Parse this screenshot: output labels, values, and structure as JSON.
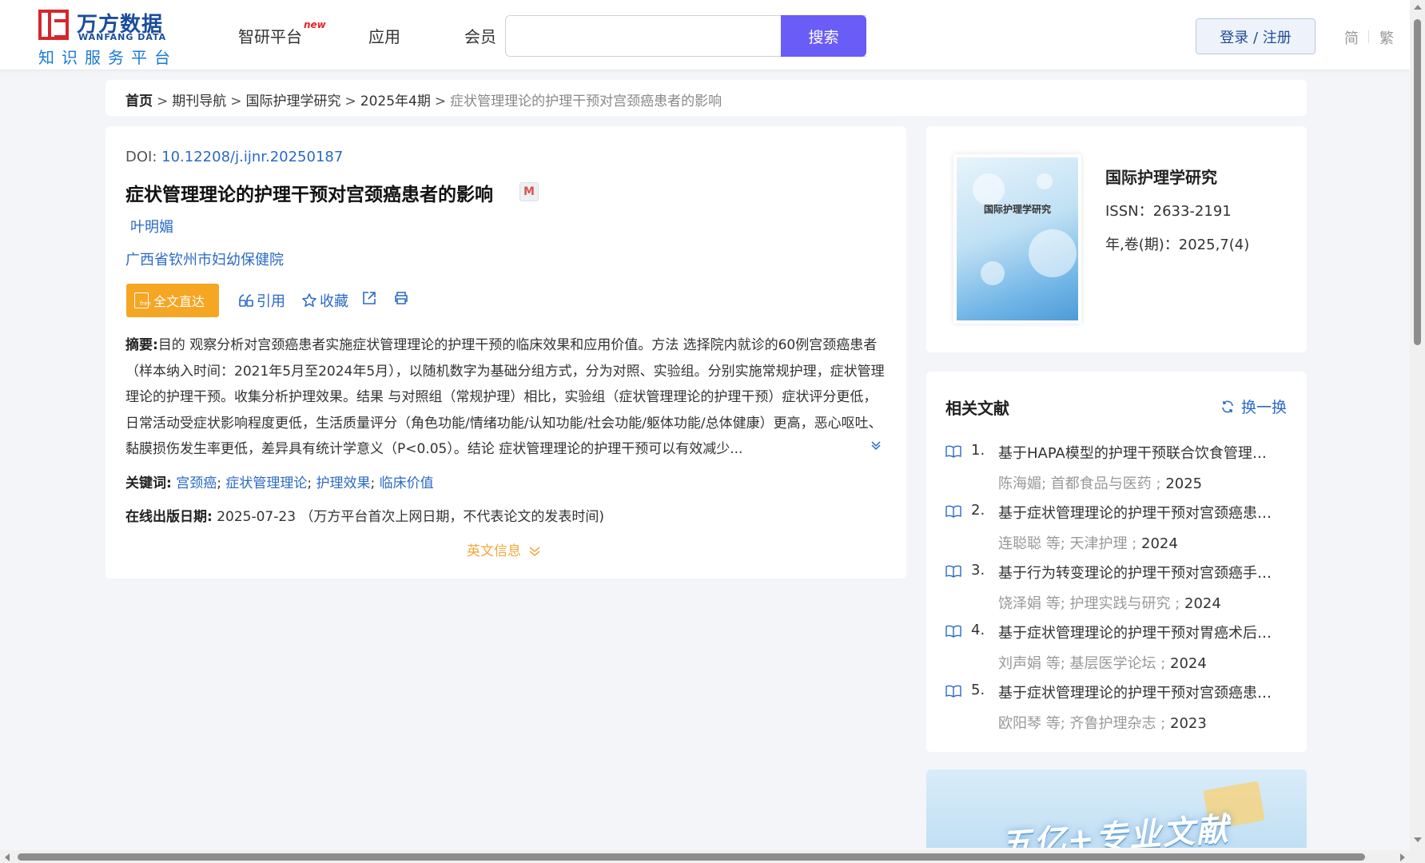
{
  "header": {
    "logo_cn": "万方数据",
    "logo_en": "WANFANG DATA",
    "logo_sub": "知识服务平台",
    "nav": [
      {
        "label": "智研平台",
        "badge": "new"
      },
      {
        "label": "应用"
      },
      {
        "label": "会员"
      }
    ],
    "search_placeholder": "",
    "search_button": "搜索",
    "login_button": "登录 / 注册",
    "lang_simplified": "简",
    "lang_traditional": "繁"
  },
  "breadcrumb": {
    "home": "首页",
    "items": [
      "期刊导航",
      "国际护理学研究",
      "2025年4期"
    ],
    "current": "症状管理理论的护理干预对宫颈癌患者的影响",
    "separator": ">"
  },
  "article": {
    "doi_label": "DOI:",
    "doi_value": "10.12208/j.ijnr.20250187",
    "title": "症状管理理论的护理干预对宫颈癌患者的影响",
    "title_badge": "M",
    "author": "叶明媚",
    "organization": "广西省钦州市妇幼保健院",
    "fulltext_button": "全文直达",
    "actions": {
      "cite": "引用",
      "collect": "收藏"
    },
    "abstract_label": "摘要:",
    "abstract_text": "目的 观察分析对宫颈癌患者实施症状管理理论的护理干预的临床效果和应用价值。方法 选择院内就诊的60例宫颈癌患者（样本纳入时间：2021年5月至2024年5月），以随机数字为基础分组方式，分为对照、实验组。分别实施常规护理，症状管理理论的护理干预。收集分析护理效果。结果 与对照组（常规护理）相比，实验组（症状管理理论的护理干预）症状评分更低，日常活动受症状影响程度更低，生活质量评分（角色功能/情绪功能/认知功能/社会功能/躯体功能/总体健康）更高，恶心呕吐、黏膜损伤发生率更低，差异具有统计学意义（P<0.05）。结论 症状管理理论的护理干预可以有效减少...",
    "keywords_label": "关键词:",
    "keywords": [
      "宫颈癌",
      "症状管理理论",
      "护理效果",
      "临床价值"
    ],
    "pubdate_label": "在线出版日期:",
    "pubdate_value": "2025-07-23 （万方平台首次上网日期，不代表论文的发表时间)",
    "english_info": "英文信息"
  },
  "journal": {
    "cover_title": "国际护理学研究",
    "name": "国际护理学研究",
    "issn": "ISSN：2633-2191",
    "volume": "年,卷(期)：2025,7(4)"
  },
  "related": {
    "title": "相关文献",
    "refresh": "换一换",
    "items": [
      {
        "num": "1.",
        "title": "基于HAPA模型的护理干预联合饮食管理对...",
        "meta": "陈海媚; 首都食品与医药 ;",
        "year": "2025"
      },
      {
        "num": "2.",
        "title": "基于症状管理理论的护理干预对宫颈癌患者...",
        "meta": "连聪聪   等;  天津护理 ;",
        "year": "2024"
      },
      {
        "num": "3.",
        "title": "基于行为转变理论的护理干预对宫颈癌手术...",
        "meta": "饶泽娟   等;  护理实践与研究 ;",
        "year": "2024"
      },
      {
        "num": "4.",
        "title": "基于症状管理理论的护理干预对胃癌术后患...",
        "meta": "刘声娟   等;  基层医学论坛 ;",
        "year": "2024"
      },
      {
        "num": "5.",
        "title": "基于症状管理理论的护理干预对宫颈癌患者...",
        "meta": "欧阳琴   等;  齐鲁护理杂志 ;",
        "year": "2023"
      }
    ]
  },
  "banner": {
    "text": "五亿+专业文献"
  },
  "colors": {
    "accent": "#6a5cf7",
    "link": "#2a6ac6",
    "fulltext": "#f5a623",
    "english_info": "#f2a73c"
  }
}
